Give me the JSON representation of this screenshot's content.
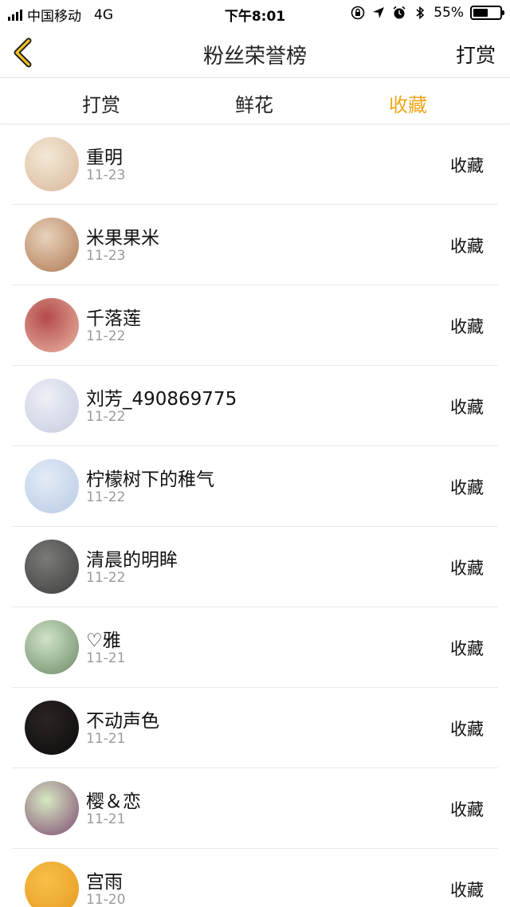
{
  "status_bar": {
    "carrier": "中国移动",
    "network": "4G",
    "time": "下午8:01",
    "battery_percent": "55%",
    "battery_level": 0.55
  },
  "nav": {
    "back_icon": "chevron-left-icon",
    "title": "粉丝荣誉榜",
    "action_label": "打赏",
    "accent_color": "#f2a51a"
  },
  "tabs": [
    {
      "label": "打赏",
      "active": false
    },
    {
      "label": "鲜花",
      "active": false
    },
    {
      "label": "收藏",
      "active": true
    }
  ],
  "fans": [
    {
      "name": "重明",
      "date": "11-23",
      "action": "收藏",
      "avatar_colors": [
        "#f3e9d6",
        "#d9b79a"
      ]
    },
    {
      "name": "米果果米",
      "date": "11-23",
      "action": "收藏",
      "avatar_colors": [
        "#e8d2bd",
        "#b07a52"
      ]
    },
    {
      "name": "千落莲",
      "date": "11-22",
      "action": "收藏",
      "avatar_colors": [
        "#b44a4a",
        "#e9b6a4"
      ]
    },
    {
      "name": "刘芳_490869775",
      "date": "11-22",
      "action": "收藏",
      "avatar_colors": [
        "#eef0f6",
        "#c6cbe0"
      ]
    },
    {
      "name": "柠檬树下的稚气",
      "date": "11-22",
      "action": "收藏",
      "avatar_colors": [
        "#e3ebf6",
        "#b9cbe6"
      ]
    },
    {
      "name": "清晨的明眸",
      "date": "11-22",
      "action": "收藏",
      "avatar_colors": [
        "#7a7a78",
        "#3e3e3c"
      ]
    },
    {
      "name": "♡雅",
      "date": "11-21",
      "action": "收藏",
      "avatar_colors": [
        "#cfe3c8",
        "#6d8a66"
      ]
    },
    {
      "name": "不动声色",
      "date": "11-21",
      "action": "收藏",
      "avatar_colors": [
        "#2a2424",
        "#0e0b0b"
      ]
    },
    {
      "name": "樱＆恋",
      "date": "11-21",
      "action": "收藏",
      "avatar_colors": [
        "#d7e8c1",
        "#7e4a73"
      ]
    },
    {
      "name": "宫雨",
      "date": "11-20",
      "action": "收藏",
      "avatar_colors": [
        "#f6c04a",
        "#e79a1f"
      ]
    }
  ]
}
